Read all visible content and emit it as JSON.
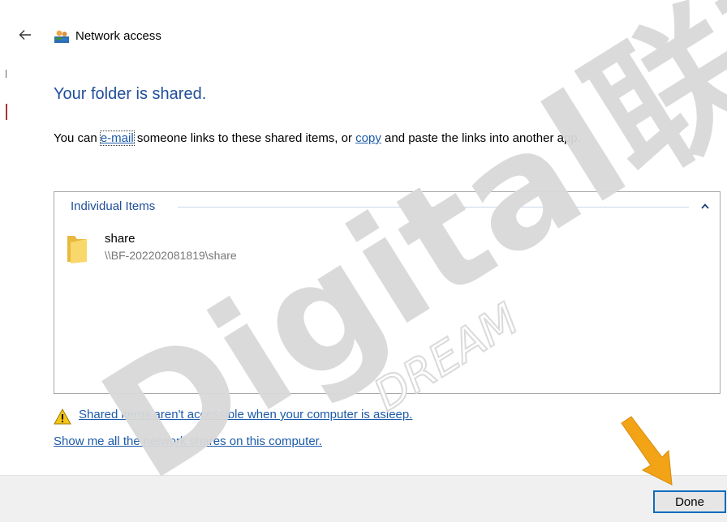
{
  "window": {
    "title": "Network access",
    "back_icon": "back-arrow-icon",
    "app_icon": "network-people-icon"
  },
  "content": {
    "heading": "Your folder is shared.",
    "description": {
      "prefix": "You can ",
      "email_link": "e-mail",
      "middle": " someone links to these shared items, or ",
      "copy_link": "copy",
      "suffix": " and paste the links into another app."
    }
  },
  "items_group": {
    "header": "Individual Items",
    "collapse_icon": "chevron-up-icon",
    "items": [
      {
        "name": "share",
        "path": "\\\\BF-202202081819\\share",
        "icon": "folder-icon"
      }
    ]
  },
  "links": {
    "asleep_warning": "Shared items aren't accessible when your computer is asleep.",
    "show_shares": "Show me all the network shares on this computer."
  },
  "footer": {
    "done_label": "Done"
  },
  "watermark": {
    "main": "Digital联想",
    "sub": "DREAM"
  },
  "colors": {
    "heading": "#1f4e9a",
    "link": "#1c5aa8",
    "footer_bg": "#f0f0f0",
    "button_border": "#0f6cbd",
    "arrow": "#f2a316",
    "watermark": "#d9d9d9"
  }
}
